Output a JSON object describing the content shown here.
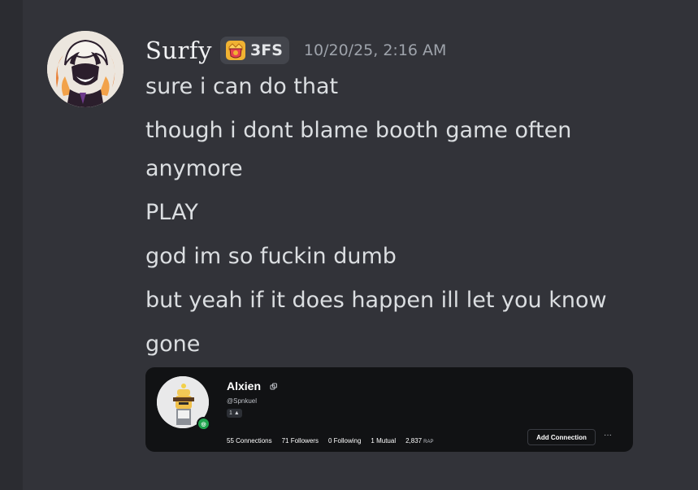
{
  "message": {
    "username": "Surfy",
    "tag": {
      "icon": "crown-shield-icon",
      "label": "3FS"
    },
    "timestamp": "10/20/25, 2:16 AM",
    "lines": [
      "sure i can do that",
      "though i dont blame booth game often",
      "anymore",
      "PLAY",
      "god im so fuckin dumb",
      "but yeah if it does happen ill let you know",
      "gone"
    ]
  },
  "embed": {
    "name": "Alxien",
    "handle": "@Spnkuel",
    "level": "1",
    "stats": {
      "connections": "55 Connections",
      "followers": "71 Followers",
      "following": "0 Following",
      "mutual": "1 Mutual",
      "rap_value": "2,837",
      "rap_label": "RAP"
    },
    "add_button": "Add Connection",
    "more_button": "···"
  },
  "colors": {
    "background": "#323339",
    "text": "#dbdee1",
    "timestamp": "#9ea3ab",
    "embed_bg": "#111214",
    "online": "#20a54e"
  }
}
